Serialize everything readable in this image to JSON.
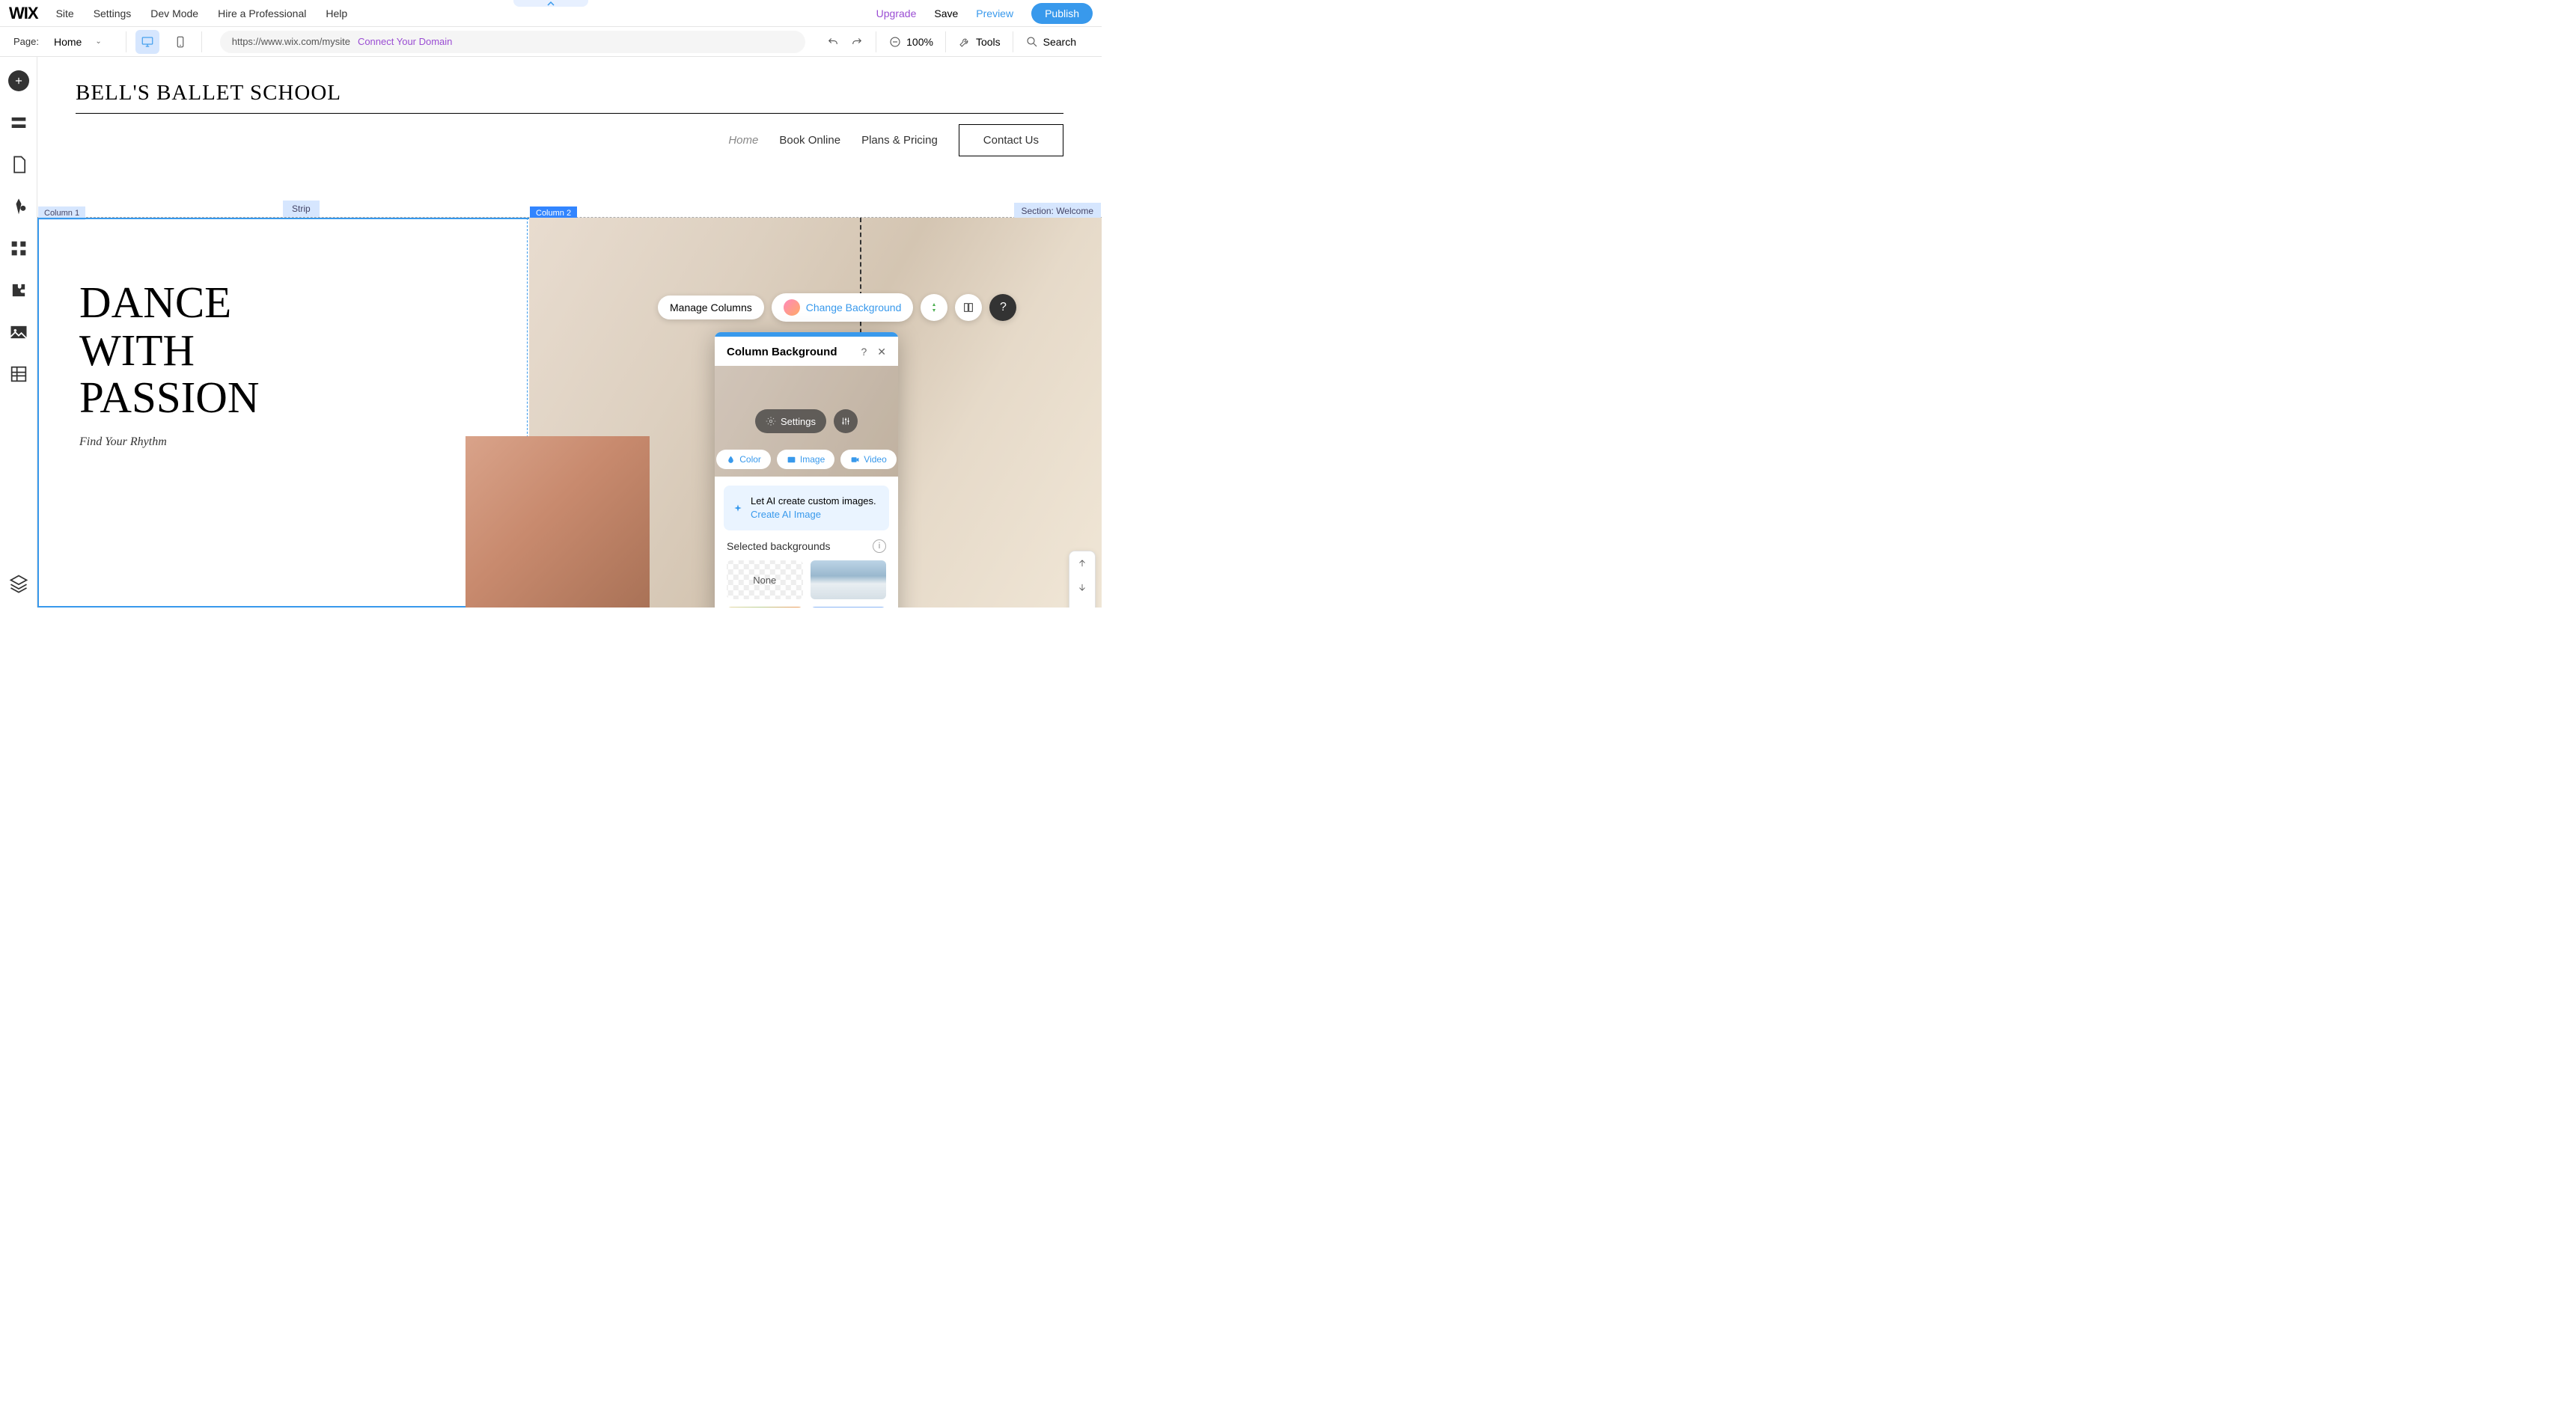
{
  "menu": {
    "logo": "WIX",
    "items": [
      "Site",
      "Settings",
      "Dev Mode",
      "Hire a Professional",
      "Help"
    ],
    "upgrade": "Upgrade",
    "save": "Save",
    "preview": "Preview",
    "publish": "Publish"
  },
  "secondary": {
    "page_label": "Page:",
    "page_name": "Home",
    "url": "https://www.wix.com/mysite",
    "connect": "Connect Your Domain",
    "zoom": "100%",
    "tools": "Tools",
    "search": "Search"
  },
  "site": {
    "title": "BELL'S BALLET SCHOOL",
    "nav": {
      "home": "Home",
      "book": "Book Online",
      "plans": "Plans & Pricing",
      "contact": "Contact Us"
    },
    "hero": "DANCE WITH PASSION",
    "sub": "Find Your Rhythm"
  },
  "labels": {
    "strip": "Strip",
    "col1": "Column 1",
    "col2": "Column 2",
    "section": "Section: Welcome"
  },
  "actions": {
    "manage": "Manage Columns",
    "change_bg": "Change Background"
  },
  "popup": {
    "title": "Column Background",
    "settings": "Settings",
    "types": {
      "color": "Color",
      "image": "Image",
      "video": "Video"
    },
    "ai_text": "Let AI create custom images. ",
    "ai_link": "Create AI Image",
    "selected": "Selected backgrounds",
    "none": "None"
  }
}
